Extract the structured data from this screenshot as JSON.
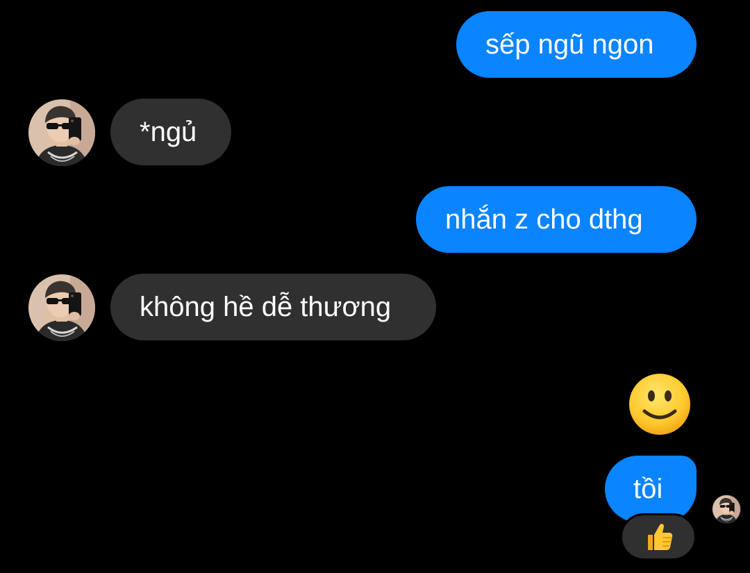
{
  "conversation": {
    "messages": [
      {
        "direction": "outgoing",
        "text": "sếp ngũ ngon"
      },
      {
        "direction": "incoming",
        "text": "*ngủ"
      },
      {
        "direction": "outgoing",
        "text": "nhắn z cho dthg"
      },
      {
        "direction": "incoming",
        "text": "không hề dễ thương"
      },
      {
        "direction": "outgoing",
        "emoji": "slightly-smiling-face"
      },
      {
        "direction": "outgoing",
        "text": "tồi",
        "reaction": "thumbs-up"
      }
    ]
  },
  "colors": {
    "background": "#000000",
    "outgoing_bubble": "#0a84ff",
    "incoming_bubble": "#303030",
    "text": "#ffffff"
  },
  "icons": {
    "contact_avatar": "contact-avatar",
    "seen_indicator": "seen-avatar",
    "emoji": "slightly-smiling-face-icon",
    "reaction": "thumbs-up-icon"
  }
}
